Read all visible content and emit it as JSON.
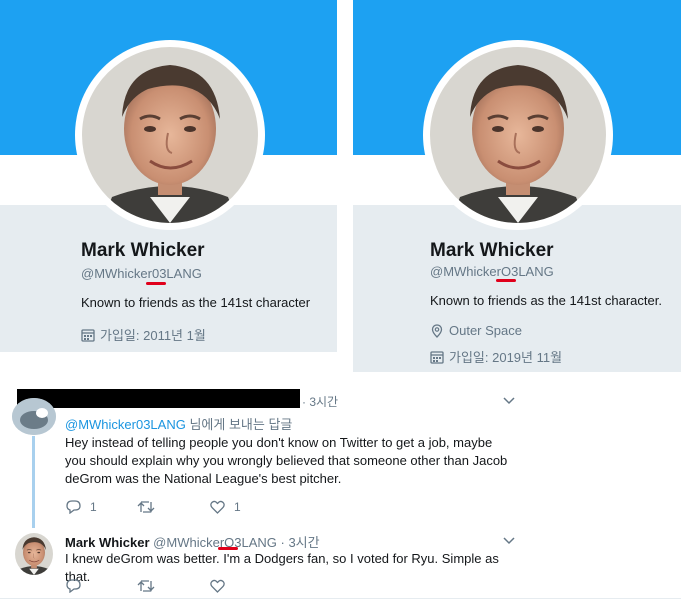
{
  "left_profile": {
    "name": "Mark Whicker",
    "handle": "@MWhicker03LANG",
    "bio": "Known to friends as the 141st character",
    "joined": "가입일: 2011년 1월"
  },
  "right_profile": {
    "name": "Mark Whicker",
    "handle": "@MWhickerO3LANG",
    "bio": "Known to friends as the 141st character.",
    "location": "Outer Space",
    "joined": "가입일: 2019년 11월"
  },
  "reply_tweet": {
    "time": "· 3시간",
    "reply_to_handle": "@MWhicker03LANG",
    "reply_to_suffix": " 님에게 보내는 답글",
    "text": "Hey instead of telling people you don't know on Twitter to get a job, maybe you should explain why you wrongly believed that someone other than Jacob deGrom was the National League's best pitcher.",
    "reply_count": "1",
    "like_count": "1"
  },
  "whicker_tweet": {
    "name": "Mark Whicker",
    "handle": "@MWhickerO3LANG",
    "time": "· 3시간",
    "text": "I knew deGrom was better. I'm a Dodgers fan, so I voted for Ryu. Simple as that."
  },
  "colors": {
    "banner": "#1da1f2",
    "card_bg": "#e6ecf0",
    "underline": "#e0001b",
    "link": "#1b95e0",
    "thread_line": "#a8d0ee"
  },
  "icons": [
    "calendar-icon",
    "location-pin-icon",
    "chevron-down-icon",
    "reply-icon",
    "retweet-icon",
    "like-icon"
  ]
}
